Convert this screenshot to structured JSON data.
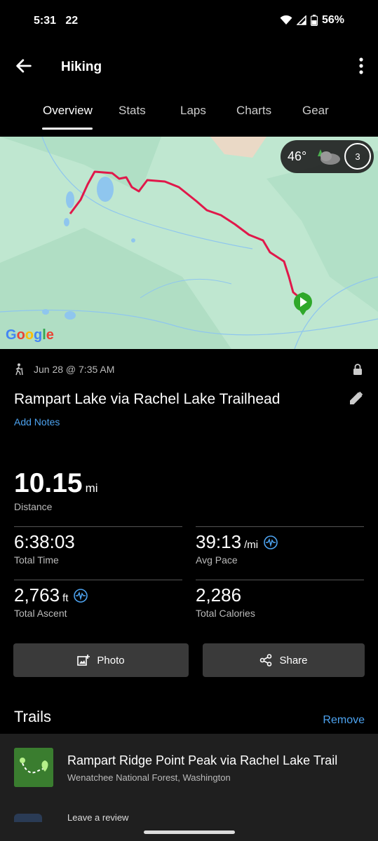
{
  "status": {
    "time": "5:31",
    "extra": "22",
    "battery": "56%"
  },
  "appbar": {
    "title": "Hiking"
  },
  "tabs": [
    "Overview",
    "Stats",
    "Laps",
    "Charts",
    "Gear"
  ],
  "map": {
    "weather_temp": "46°",
    "weather_count": "3",
    "provider": "Google"
  },
  "activity": {
    "date": "Jun 28 @ 7:35 AM",
    "title": "Rampart Lake via Rachel Lake Trailhead",
    "add_notes": "Add Notes",
    "distance": "10.15",
    "distance_unit": "mi",
    "distance_label": "Distance"
  },
  "stats": [
    {
      "value": "6:38:03",
      "unit": "",
      "label": "Total Time"
    },
    {
      "value": "39:13",
      "unit": "/mi",
      "label": "Avg Pace"
    },
    {
      "value": "2,763",
      "unit": "ft",
      "label": "Total Ascent"
    },
    {
      "value": "2,286",
      "unit": "",
      "label": "Total Calories"
    }
  ],
  "buttons": {
    "photo": "Photo",
    "share": "Share"
  },
  "trails": {
    "heading": "Trails",
    "remove": "Remove",
    "name": "Rampart Ridge Point Peak via Rachel Lake Trail",
    "location": "Wenatchee National Forest, Washington",
    "review": "Leave a review"
  },
  "colors": {
    "accent": "#4da3f0",
    "route": "#e0184a",
    "map_bg": "#bfe7d0",
    "pin": "#2fa82a"
  }
}
